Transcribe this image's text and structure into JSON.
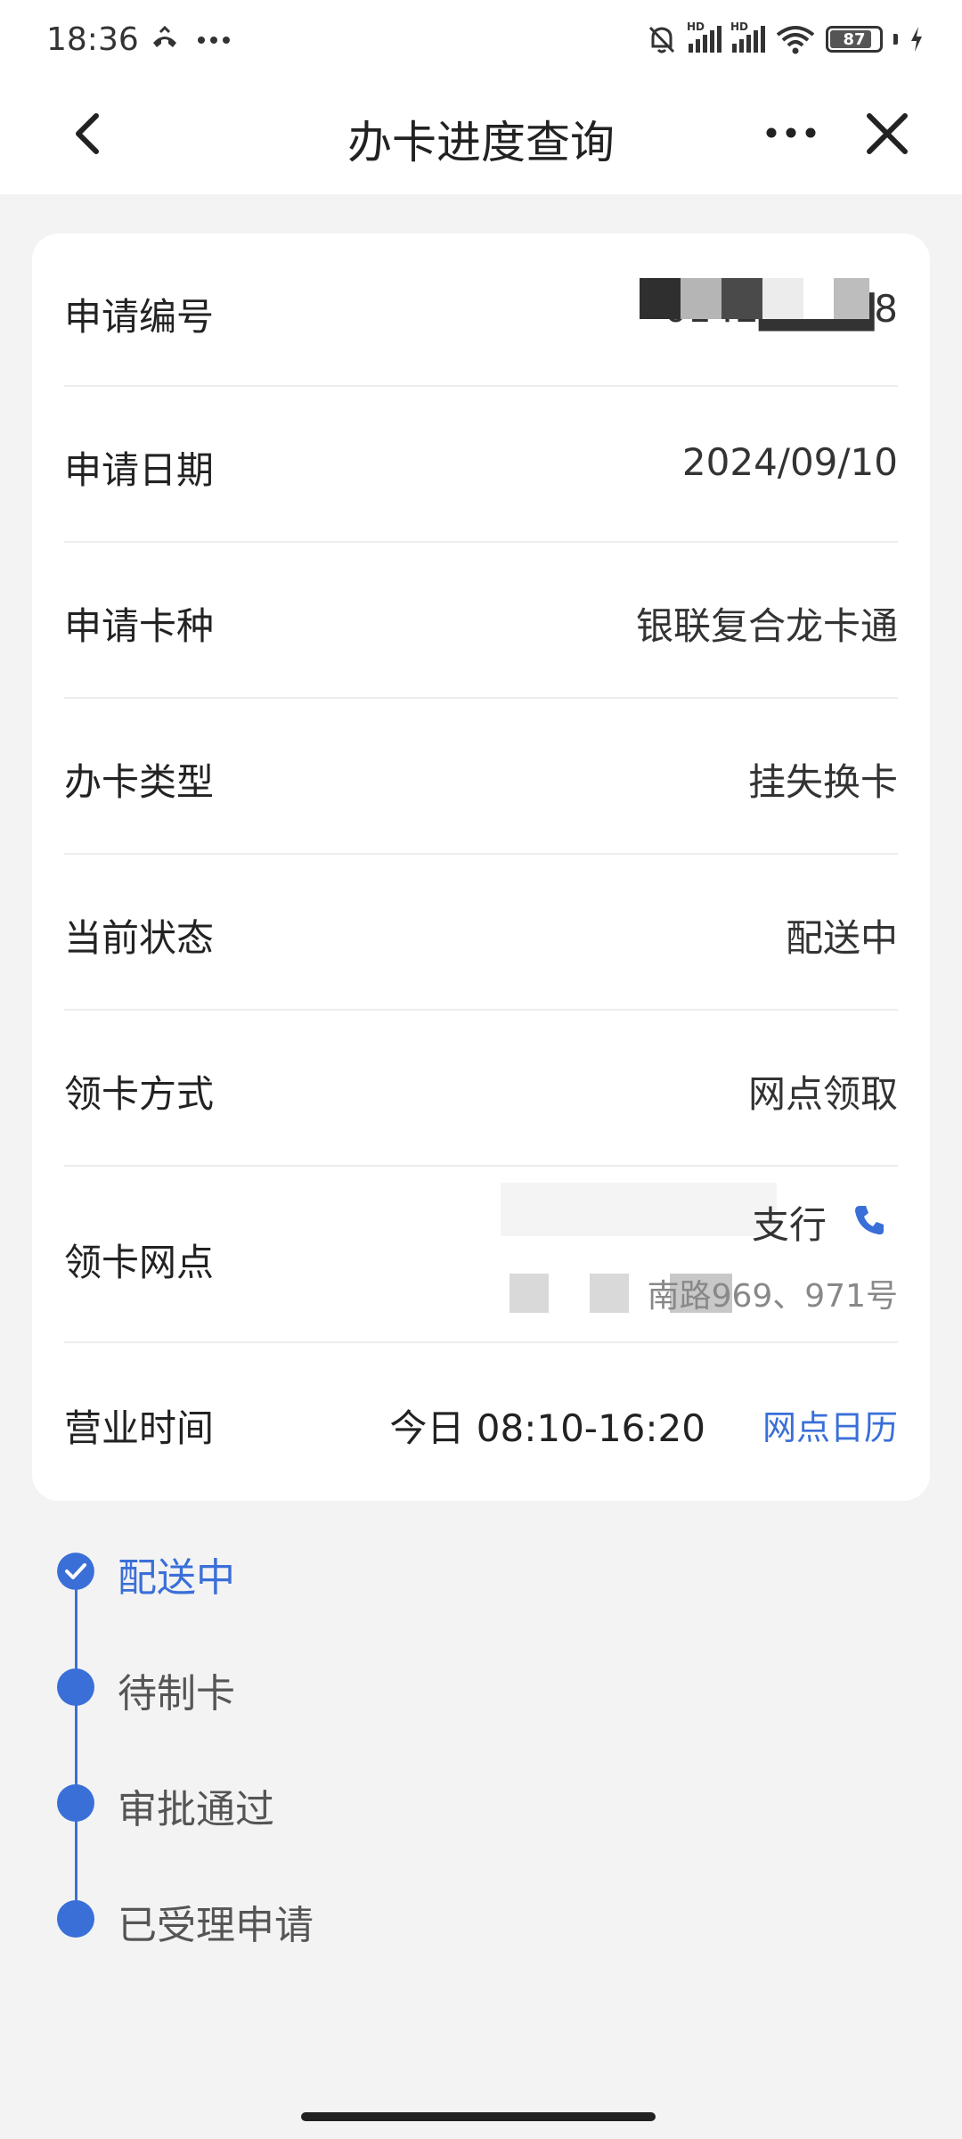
{
  "status_bar": {
    "time": "18:36",
    "left_icons": [
      "call-icon",
      "more-dots-icon"
    ],
    "right_icons": [
      "mute-bell-icon",
      "signal-hd-icon",
      "signal-hd-icon",
      "wifi-icon",
      "battery-icon",
      "charging-icon"
    ],
    "hd_label": "HD",
    "battery_level": "87"
  },
  "nav": {
    "title": "办卡进度查询"
  },
  "details": [
    {
      "label": "申请编号",
      "value": "0142▇▇▇▇8"
    },
    {
      "label": "申请日期",
      "value": "2024/09/10"
    },
    {
      "label": "申请卡种",
      "value": "银联复合龙卡通"
    },
    {
      "label": "办卡类型",
      "value": "挂失换卡"
    },
    {
      "label": "当前状态",
      "value": "配送中"
    },
    {
      "label": "领卡方式",
      "value": "网点领取"
    },
    {
      "label": "领卡网点",
      "value": "支行",
      "sub": "南路969、971号"
    },
    {
      "label": "营业时间",
      "value": "今日 08:10-16:20",
      "link": "网点日历"
    }
  ],
  "timeline": [
    {
      "label": "配送中",
      "active": true
    },
    {
      "label": "待制卡",
      "active": false
    },
    {
      "label": "审批通过",
      "active": false
    },
    {
      "label": "已受理申请",
      "active": false
    }
  ],
  "colors": {
    "accent": "#3a6fd8",
    "background": "#f3f3f3",
    "card": "#ffffff"
  }
}
